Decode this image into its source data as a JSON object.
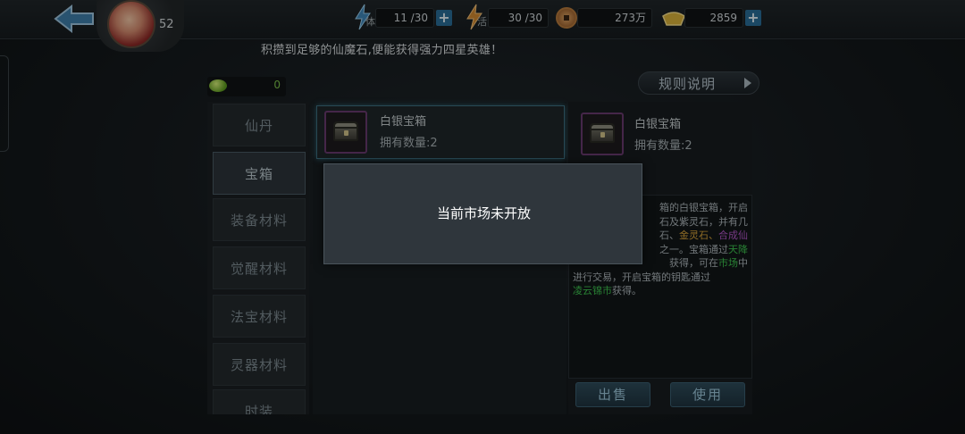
{
  "header": {
    "level": "52",
    "stamina": {
      "tag": "体",
      "value": "11 /30"
    },
    "energy": {
      "tag": "活",
      "value": "30 /30"
    },
    "coins": {
      "value": "273万"
    },
    "gold": {
      "value": "2859"
    },
    "plus_label": "+"
  },
  "notice": "积攒到足够的仙魔石,便能获得强力四星英雄！",
  "currency": {
    "gem_count": "0"
  },
  "rules_button": "规则说明",
  "categories": [
    "仙丹",
    "宝箱",
    "装备材料",
    "觉醒材料",
    "法宝材料",
    "灵器材料",
    "时装"
  ],
  "active_category": "宝箱",
  "items": [
    {
      "name": "白银宝箱",
      "qty_label": "拥有数量:2"
    }
  ],
  "detail": {
    "name": "白银宝箱",
    "qty_label": "拥有数量:2",
    "desc_line1": "箱的白银宝箱，开启",
    "desc_line2": "石及紫灵石，并有几",
    "desc_line3_end": "石、",
    "desc_line3_gold": "金灵石、",
    "desc_line3_purple": "合成仙",
    "desc_line4": "之一。宝箱通过",
    "desc_line4_green": "天降",
    "desc_line5": "获得，可在",
    "desc_line5_green": "市场",
    "desc_line5_end": "中",
    "desc_line6": "进行交易，开启宝箱的钥匙通过",
    "desc_line7_green": "凌云锦市",
    "desc_line7_end": "获得。",
    "sell_button": "出售",
    "use_button": "使用"
  },
  "popup": {
    "message": "当前市场未开放"
  },
  "colors": {
    "accent": "#2a6e98",
    "highlight_green": "#3ec64f",
    "highlight_gold": "#d9a43a",
    "highlight_purple": "#b457c8"
  }
}
